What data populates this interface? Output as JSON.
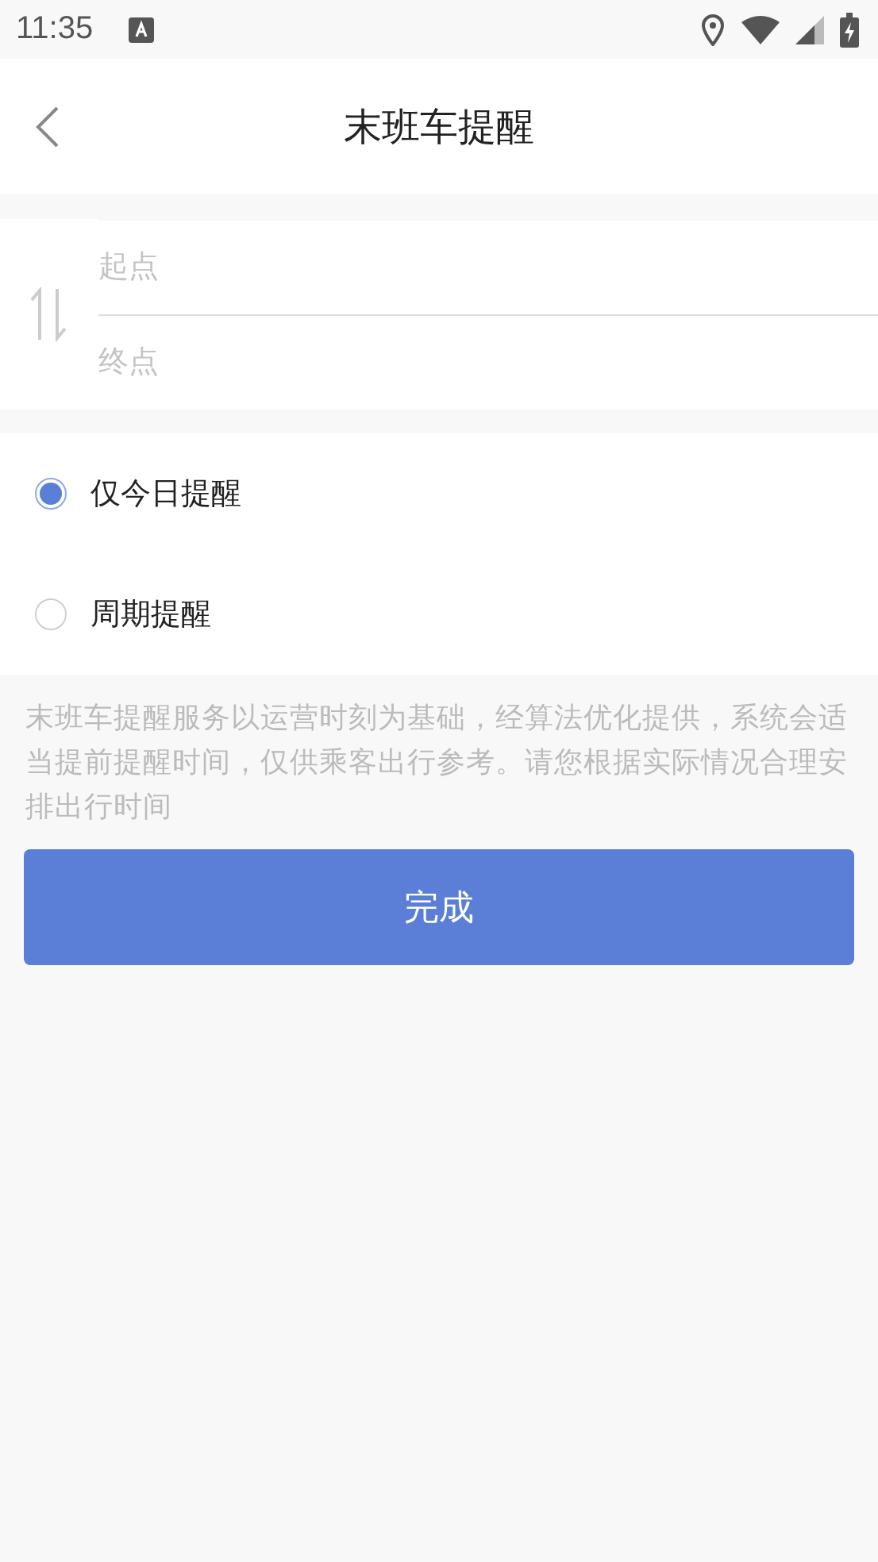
{
  "status_bar": {
    "time": "11:35"
  },
  "header": {
    "title": "末班车提醒"
  },
  "route": {
    "from": {
      "placeholder": "起点"
    },
    "to": {
      "placeholder": "终点"
    }
  },
  "options": [
    {
      "label": "仅今日提醒",
      "selected": true
    },
    {
      "label": "周期提醒",
      "selected": false
    }
  ],
  "notice": "末班车提醒服务以运营时刻为基础，经算法优化提供，系统会适当提前提醒时间，仅供乘客出行参考。请您根据实际情况合理安排出行时间",
  "buttons": [
    {
      "label": "完成"
    }
  ]
}
